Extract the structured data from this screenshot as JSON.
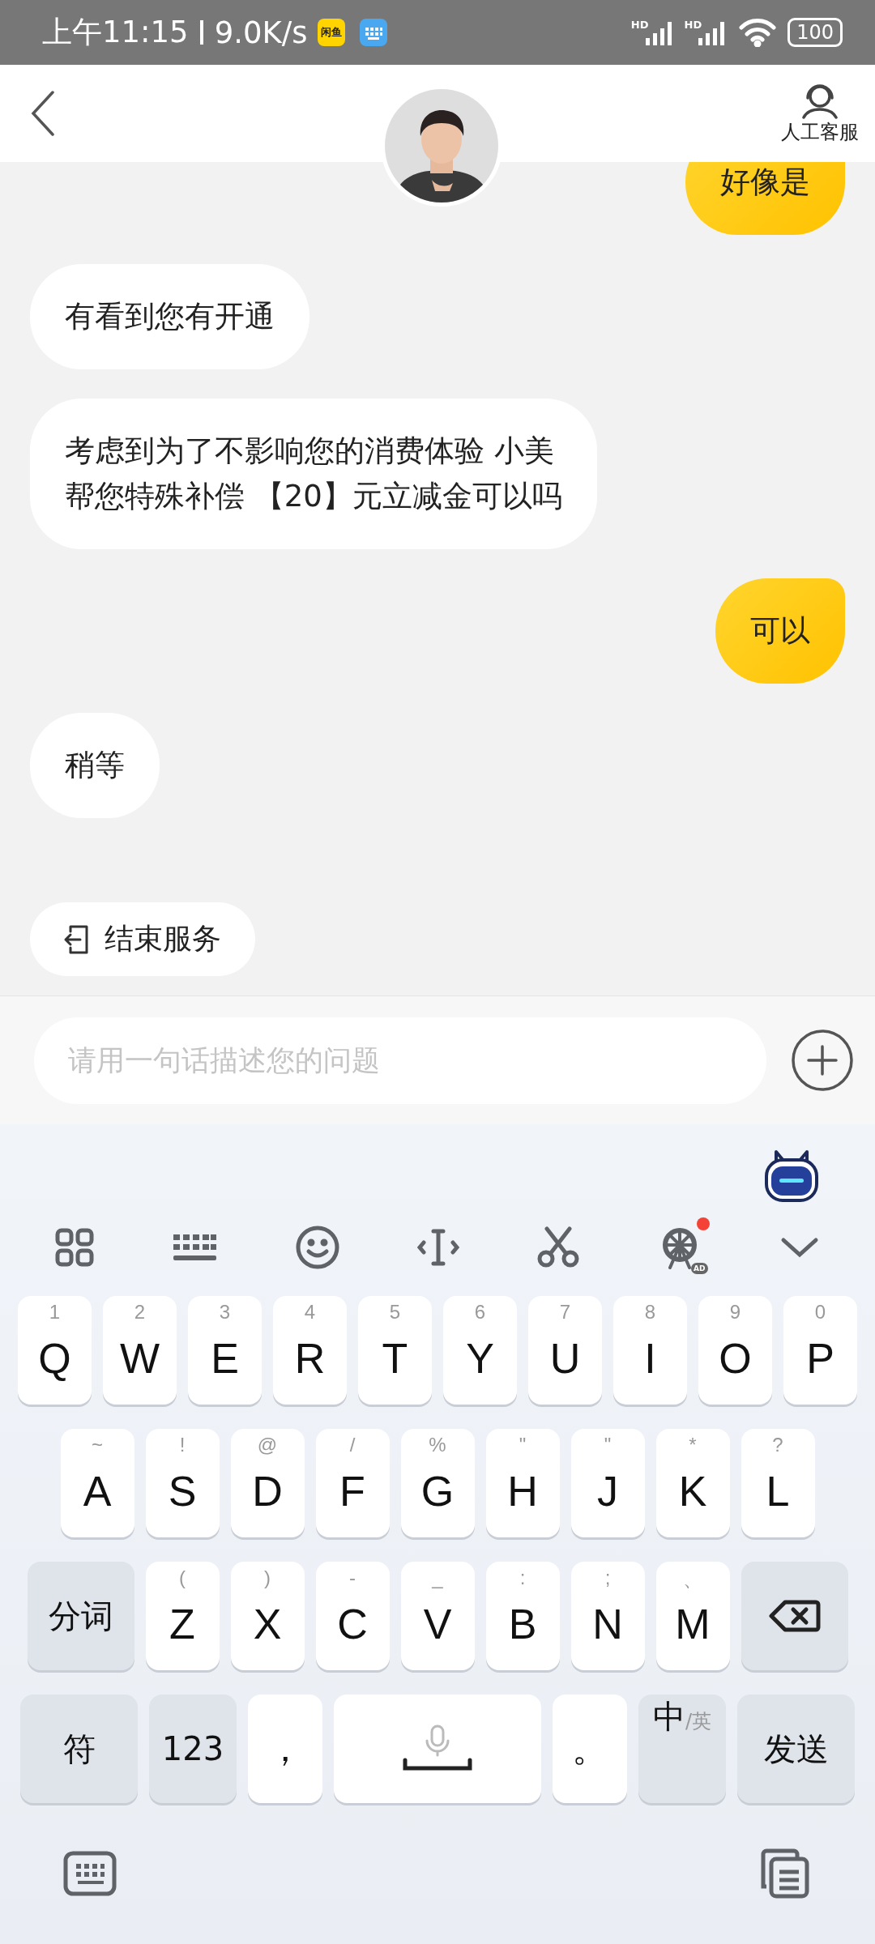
{
  "status_bar": {
    "time": "上午11:15",
    "speed": "9.0K/s",
    "app_badge": "闲鱼",
    "signal_labels": [
      "HD",
      "HD"
    ],
    "battery": "100"
  },
  "header": {
    "agent_label": "人工客服"
  },
  "messages": [
    {
      "kind": "outgoing",
      "text": "好像是"
    },
    {
      "kind": "incoming",
      "text": "有看到您有开通"
    },
    {
      "kind": "incoming",
      "text": "考虑到为了不影响您的消费体验 小美帮您特殊补偿 【20】元立减金可以吗"
    },
    {
      "kind": "outgoing",
      "text": "可以"
    },
    {
      "kind": "incoming",
      "text": "稍等"
    }
  ],
  "quick_actions": [
    {
      "label": "结束服务"
    }
  ],
  "input": {
    "placeholder": "请用一句话描述您的问题"
  },
  "keyboard": {
    "toolbar": [
      {
        "kind": "grid"
      },
      {
        "kind": "keyboard"
      },
      {
        "kind": "emoji"
      },
      {
        "kind": "cursor"
      },
      {
        "kind": "scissors"
      },
      {
        "kind": "wheel",
        "tag": "AD",
        "notification": true
      },
      {
        "kind": "collapse"
      }
    ],
    "rows": [
      {
        "keys": [
          {
            "kind": "letter",
            "hint": "1",
            "label": "Q"
          },
          {
            "kind": "letter",
            "hint": "2",
            "label": "W"
          },
          {
            "kind": "letter",
            "hint": "3",
            "label": "E"
          },
          {
            "kind": "letter",
            "hint": "4",
            "label": "R"
          },
          {
            "kind": "letter",
            "hint": "5",
            "label": "T"
          },
          {
            "kind": "letter",
            "hint": "6",
            "label": "Y"
          },
          {
            "kind": "letter",
            "hint": "7",
            "label": "U"
          },
          {
            "kind": "letter",
            "hint": "8",
            "label": "I"
          },
          {
            "kind": "letter",
            "hint": "9",
            "label": "O"
          },
          {
            "kind": "letter",
            "hint": "0",
            "label": "P"
          }
        ]
      },
      {
        "keys": [
          {
            "kind": "letter",
            "hint": "~",
            "label": "A"
          },
          {
            "kind": "letter",
            "hint": "!",
            "label": "S"
          },
          {
            "kind": "letter",
            "hint": "@",
            "label": "D"
          },
          {
            "kind": "letter",
            "hint": "/",
            "label": "F"
          },
          {
            "kind": "letter",
            "hint": "%",
            "label": "G"
          },
          {
            "kind": "letter",
            "hint": "\"",
            "label": "H"
          },
          {
            "kind": "letter",
            "hint": "\"",
            "label": "J"
          },
          {
            "kind": "letter",
            "hint": "*",
            "label": "K"
          },
          {
            "kind": "letter",
            "hint": "?",
            "label": "L"
          }
        ]
      },
      {
        "keys": [
          {
            "kind": "function",
            "label": "分词"
          },
          {
            "kind": "letter",
            "hint": "(",
            "label": "Z"
          },
          {
            "kind": "letter",
            "hint": ")",
            "label": "X"
          },
          {
            "kind": "letter",
            "hint": "-",
            "label": "C"
          },
          {
            "kind": "letter",
            "hint": "_",
            "label": "V"
          },
          {
            "kind": "letter",
            "hint": ":",
            "label": "B"
          },
          {
            "kind": "letter",
            "hint": ";",
            "label": "N"
          },
          {
            "kind": "letter",
            "hint": "、",
            "label": "M"
          },
          {
            "kind": "backspace"
          }
        ]
      },
      {
        "keys": [
          {
            "kind": "function",
            "label": "符"
          },
          {
            "kind": "function",
            "label": "123"
          },
          {
            "kind": "punct",
            "label": "，"
          },
          {
            "kind": "space"
          },
          {
            "kind": "punct",
            "label": "。"
          },
          {
            "kind": "lang",
            "label": "中",
            "sub": "/英"
          },
          {
            "kind": "function",
            "label": "发送"
          }
        ]
      }
    ]
  }
}
